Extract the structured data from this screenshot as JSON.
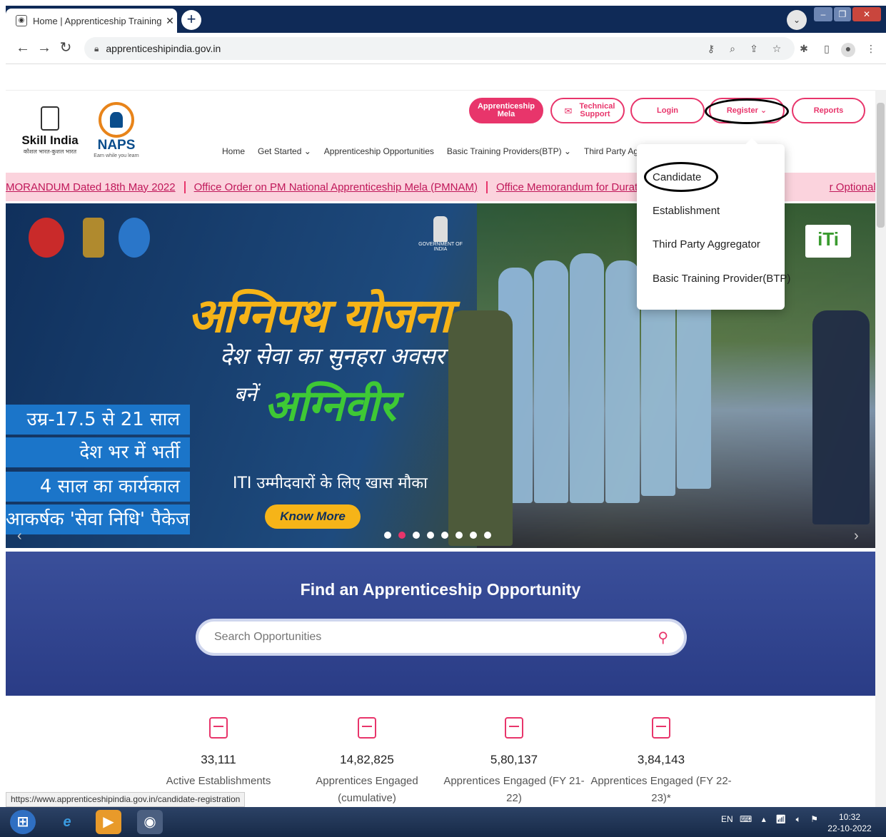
{
  "browser": {
    "tab_title": "Home | Apprenticeship Training F",
    "tab_close": "✕",
    "new_tab": "+",
    "url": "apprenticeshipindia.gov.in",
    "status_url": "https://www.apprenticeshipindia.gov.in/candidate-registration"
  },
  "header": {
    "skill_india": "Skill India",
    "skill_india_tag": "कौशल भारत-कुशल भारत",
    "naps": "NAPS",
    "naps_tag": "Earn while you learn",
    "buttons": {
      "mela": "Apprenticeship Mela",
      "support": "Technical Support",
      "login": "Login",
      "register": "Register ⌄",
      "reports": "Reports"
    }
  },
  "nav": {
    "items": [
      "Home",
      "Get Started ⌄",
      "Apprenticeship Opportunities",
      "Basic Training Providers(BTP) ⌄",
      "Third Party Aggregato"
    ]
  },
  "ticker": {
    "items": [
      "MORANDUM Dated 18th May 2022",
      "Office Order on PM National Apprenticeship Mela (PMNAM)",
      "Office Memorandum for Duration o",
      "r Optional Trade"
    ]
  },
  "register_menu": {
    "options": [
      "Candidate",
      "Establishment",
      "Third Party Aggregator",
      "Basic Training Provider(BTP)"
    ]
  },
  "hero": {
    "emblem_text": "GOVERNMENT OF INDIA",
    "title": "अग्निपथ योजना",
    "subtitle": "देश सेवा का सुनहरा अवसर",
    "bane": "बनें",
    "agniveer": "अग्निवीर",
    "bars": [
      "उम्र-17.5 से 21 साल",
      "देश भर में भर्ती",
      "4 साल का कार्यकाल",
      "आकर्षक 'सेवा निधि' पैकेज"
    ],
    "iti_line": "ITI उम्मीदवारों के लिए खास मौका",
    "know_more": "Know More",
    "iti_logo": "iTi",
    "slide_count": 8,
    "active_slide": 1
  },
  "search": {
    "title": "Find an Apprenticeship Opportunity",
    "placeholder": "Search Opportunities"
  },
  "stats": [
    {
      "value": "33,111",
      "label": "Active Establishments"
    },
    {
      "value": "14,82,825",
      "label": "Apprentices Engaged (cumulative)"
    },
    {
      "value": "5,80,137",
      "label": "Apprentices Engaged (FY 21-22)"
    },
    {
      "value": "3,84,143",
      "label": "Apprentices Engaged (FY 22-23)*"
    }
  ],
  "taskbar": {
    "lang": "EN",
    "time": "10:32",
    "date": "22-10-2022"
  },
  "colors": {
    "brand_pink": "#e8356b",
    "brand_blue": "#0a4d8c",
    "hero_gold": "#f6b418",
    "agniveer_green": "#3ec935",
    "search_band": "#2a3c86"
  }
}
